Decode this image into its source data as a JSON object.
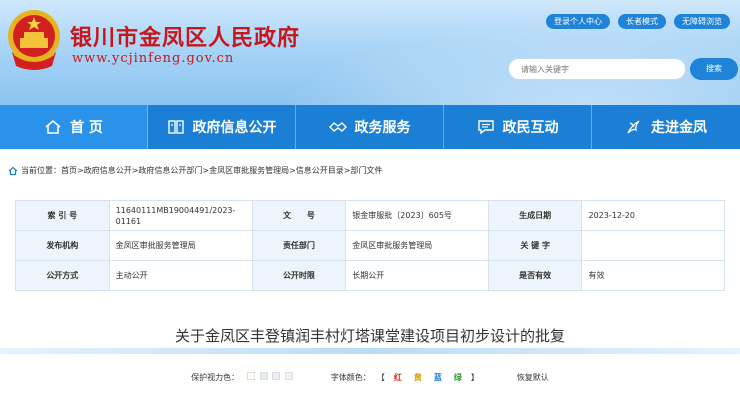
{
  "header": {
    "site_title": "银川市金凤区人民政府",
    "site_url": "www.ycjinfeng.gov.cn",
    "top_links": [
      "登录个人中心",
      "长者模式",
      "无障碍浏览"
    ],
    "search_placeholder": "请输入关键字",
    "search_button": "搜索"
  },
  "nav": {
    "items": [
      "首 页",
      "政府信息公开",
      "政务服务",
      "政民互动",
      "走进金凤"
    ]
  },
  "breadcrumb": {
    "text": "当前位置：首页>政府信息公开>政府信息公开部门>金凤区审批服务管理局>信息公开目录>部门文件"
  },
  "info_table": {
    "rows": [
      [
        "索 引 号",
        "11640111MB19004491/2023-01161",
        "文　　号",
        "银金审服批〔2023〕605号",
        "生成日期",
        "2023-12-20"
      ],
      [
        "发布机构",
        "金凤区审批服务管理局",
        "责任部门",
        "金凤区审批服务管理局",
        "关 键 字",
        ""
      ],
      [
        "公开方式",
        "主动公开",
        "公开时限",
        "长期公开",
        "是否有效",
        "有效"
      ]
    ]
  },
  "document": {
    "title": "关于金凤区丰登镇润丰村灯塔课堂建设项目初步设计的批复"
  },
  "tools": {
    "eye_label": "保护视力色：",
    "eye_colors": [
      "#fdfdf1",
      "#e4f2e3",
      "#e6eef7",
      "#f0f0f0"
    ],
    "font_color_label": "字体颜色：",
    "bracket_open": "【",
    "font_colors": [
      {
        "label": "红",
        "color": "#e02020"
      },
      {
        "label": "黄",
        "color": "#d4a500"
      },
      {
        "label": "蓝",
        "color": "#1b7fd6"
      },
      {
        "label": "绿",
        "color": "#2aa02a"
      }
    ],
    "bracket_close": "】",
    "reset_label": "恢复默认"
  },
  "colors": {
    "nav_bg": "#1b7fd6",
    "title_red": "#c8161d"
  }
}
